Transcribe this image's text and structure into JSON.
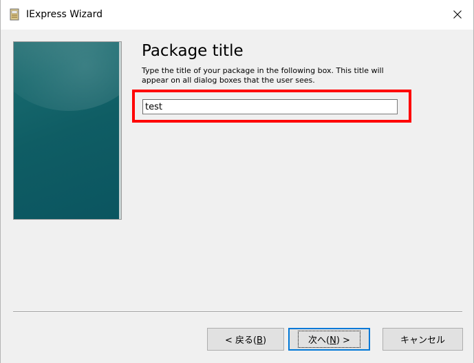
{
  "window": {
    "title": "IExpress Wizard",
    "app_icon": "iexpress-package-icon",
    "close_icon": "close-icon"
  },
  "page": {
    "heading": "Package title",
    "description": "Type the title of your package in the following box. This title will appear on all dialog boxes that the user sees."
  },
  "title_input": {
    "value": "test"
  },
  "buttons": {
    "back": {
      "prefix": "< 戻る(",
      "accel": "B",
      "suffix": ")"
    },
    "next": {
      "prefix": "次へ(",
      "accel": "N",
      "suffix": ") >"
    },
    "cancel": "キャンセル"
  },
  "colors": {
    "highlight": "#ff0000",
    "focus": "#0078d7",
    "side_image": "#0f5d64"
  }
}
